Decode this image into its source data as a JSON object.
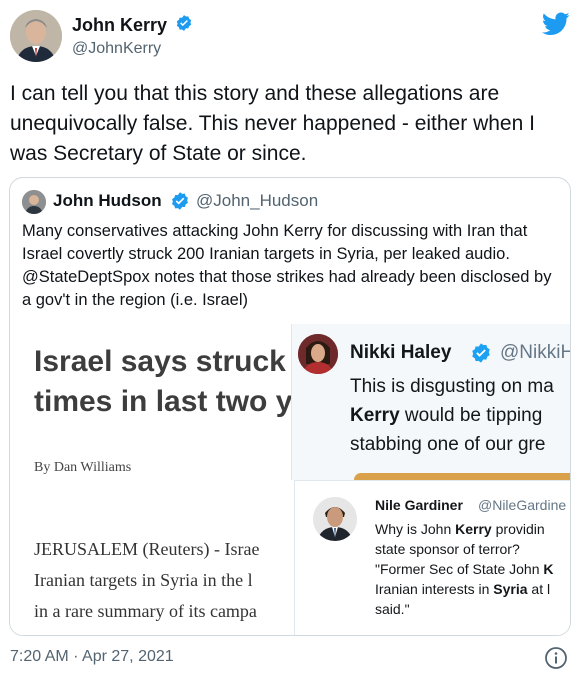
{
  "tweet": {
    "author_name": "John Kerry",
    "author_handle": "@JohnKerry",
    "text": "I can tell you that this story and these allegations are unequivocally false. This never happened - either when I was Secretary of State or since.",
    "timestamp": "7:20 AM · Apr 27, 2021"
  },
  "quote": {
    "author_name": "John Hudson",
    "author_handle": "@John_Hudson",
    "text": "Many conservatives attacking John Kerry for discussing with Iran that Israel covertly struck 200 Iranian targets in Syria, per leaked audio. @StateDeptSpox notes that those strikes had already been disclosed by a gov't in the region (i.e. Israel)"
  },
  "media": {
    "reuters": {
      "headline_line1": "Israel says struck",
      "headline_line2": "times in last two y",
      "byline": "By Dan Williams",
      "body_line1": "JERUSALEM (Reuters) - Israe",
      "body_line2": "Iranian targets in Syria in the l",
      "body_line3": "in a rare summary of its campa"
    },
    "haley": {
      "name": "Nikki Haley",
      "handle": "@NikkiH",
      "line1": "This is disgusting on ma",
      "line2_bold": "Kerry",
      "line2_rest": " would be tipping",
      "line3": "stabbing one of our gre"
    },
    "gardiner": {
      "name": "Nile Gardiner",
      "handle": "@NileGardine",
      "line1_pre": "Why is John ",
      "line1_bold": "Kerry",
      "line1_post": " providin",
      "line2": "state sponsor of terror?",
      "line3_pre": "\"Former Sec of State John ",
      "line3_bold": "K",
      "line4_pre": "Iranian interests in ",
      "line4_bold": "Syria",
      "line4_post": " at l",
      "line5": "said.\""
    }
  },
  "colors": {
    "twitter_blue": "#1d9bf0",
    "text_primary": "#0f1419",
    "text_secondary": "#536471",
    "border": "#cfd9de"
  },
  "icons": {
    "brand": "twitter-bird-icon",
    "verified": "verified-badge-icon",
    "info": "info-icon"
  }
}
